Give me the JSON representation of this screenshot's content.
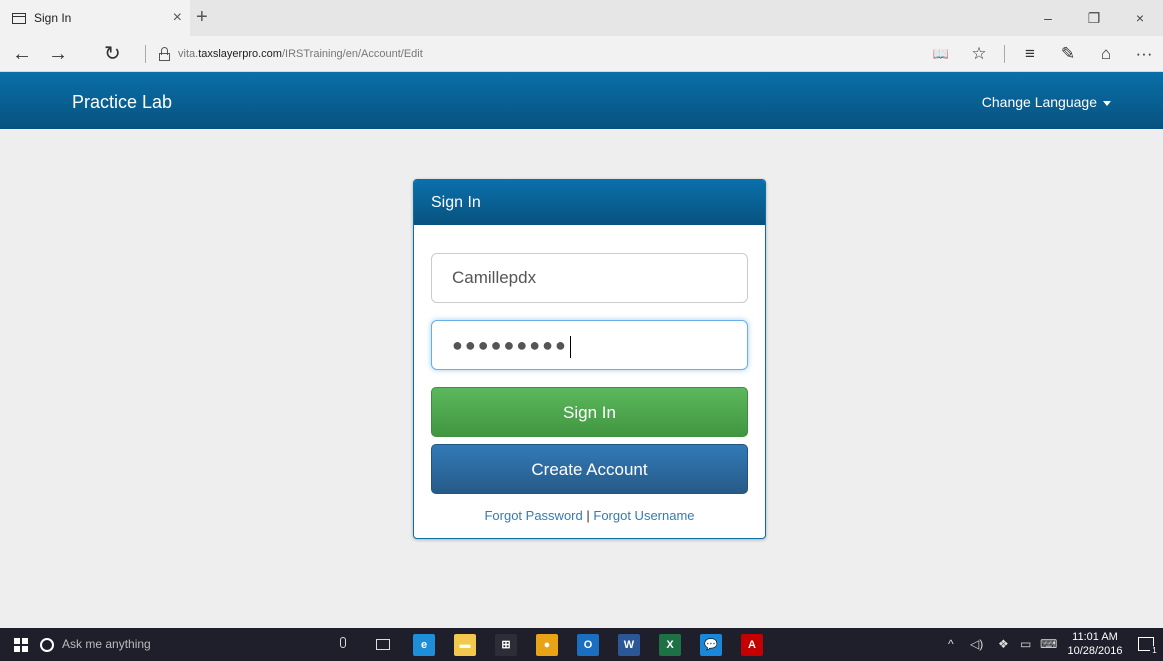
{
  "browser": {
    "tab_title": "Sign In",
    "tab_close": "×",
    "new_tab": "+",
    "minimize": "–",
    "restore": "❐",
    "close": "×",
    "url_prefix": "vita.",
    "url_domain": "taxslayerpro.com",
    "url_path": "/IRSTraining/en/Account/Edit",
    "back": "←",
    "forward": "→",
    "refresh": "↻",
    "reading_view": "📖",
    "favorite": "☆",
    "hub": "≡",
    "web_note": "✎",
    "share": "⌂",
    "more": "···"
  },
  "navbar": {
    "brand": "Practice Lab",
    "change_language": "Change Language"
  },
  "signin": {
    "heading": "Sign In",
    "username_value": "Camillepdx",
    "password_masked": "●●●●●●●●●",
    "signin_button": "Sign In",
    "create_button": "Create Account",
    "forgot_password": "Forgot Password",
    "separator": "|",
    "forgot_username": "Forgot Username"
  },
  "taskbar": {
    "search_placeholder": "Ask me anything",
    "apps": [
      {
        "name": "edge-icon",
        "label": "e",
        "color": "#1e8ed8"
      },
      {
        "name": "file-explorer-icon",
        "label": "▬",
        "color": "#f2c94c"
      },
      {
        "name": "store-icon",
        "label": "⊞",
        "color": "#2d2d38"
      },
      {
        "name": "chrome-icon",
        "label": "●",
        "color": "#e8a317"
      },
      {
        "name": "outlook-icon",
        "label": "O",
        "color": "#1a6fc0"
      },
      {
        "name": "word-icon",
        "label": "W",
        "color": "#2b5797"
      },
      {
        "name": "excel-icon",
        "label": "X",
        "color": "#1e7145"
      },
      {
        "name": "skype-icon",
        "label": "💬",
        "color": "#1a88d8"
      },
      {
        "name": "acrobat-icon",
        "label": "A",
        "color": "#c40000"
      }
    ],
    "tray_chevron": "^",
    "tray_volume": "◁)",
    "tray_dropbox": "❖",
    "tray_battery": "▭",
    "tray_keyboard": "⌨",
    "time": "11:01 AM",
    "date": "10/28/2016",
    "notification_count": "1"
  }
}
